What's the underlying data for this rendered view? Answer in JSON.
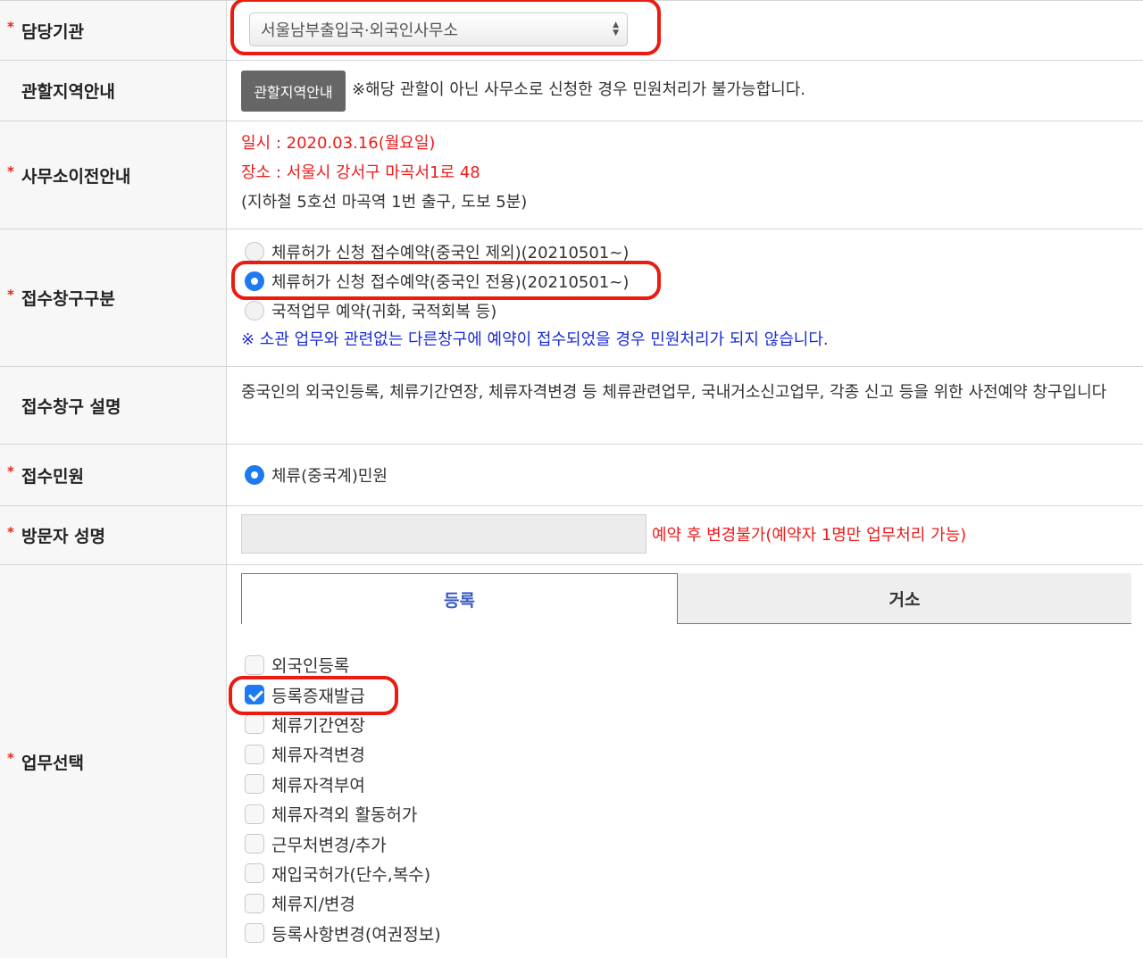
{
  "agency": {
    "label": "담당기관",
    "value": "서울남부출입국·외국인사무소"
  },
  "area": {
    "label": "관할지역안내",
    "button": "관할지역안내",
    "note": "※해당 관할이 아닌 사무소로 신청한 경우 민원처리가 불가능합니다."
  },
  "relocation": {
    "label": "사무소이전안내",
    "date": "일시 : 2020.03.16(월요일)",
    "place": "장소 : 서울시 강서구 마곡서1로 48",
    "access": "(지하철 5호선 마곡역 1번 출구, 도보 5분)"
  },
  "window_type": {
    "label": "접수창구구분",
    "options": [
      {
        "label": "체류허가 신청 접수예약(중국인 제외)(20210501~)",
        "selected": false
      },
      {
        "label": "체류허가 신청 접수예약(중국인 전용)(20210501~)",
        "selected": true
      },
      {
        "label": "국적업무 예약(귀화, 국적회복 등)",
        "selected": false
      }
    ],
    "warning": "※ 소관 업무와 관련없는 다른창구에 예약이 접수되었을 경우 민원처리가 되지 않습니다."
  },
  "window_desc": {
    "label": "접수창구 설명",
    "text": "중국인의 외국인등록, 체류기간연장, 체류자격변경 등 체류관련업무, 국내거소신고업무, 각종 신고 등을 위한 사전예약 창구입니다"
  },
  "civil": {
    "label": "접수민원",
    "option": "체류(중국계)민원",
    "selected": true
  },
  "visitor": {
    "label": "방문자 성명",
    "value": "",
    "note": "예약 후 변경불가(예약자 1명만 업무처리 가능)"
  },
  "task": {
    "label": "업무선택",
    "tabs": [
      {
        "label": "등록",
        "active": true
      },
      {
        "label": "거소",
        "active": false
      }
    ],
    "items": [
      {
        "label": "외국인등록",
        "checked": false
      },
      {
        "label": "등록증재발급",
        "checked": true
      },
      {
        "label": "체류기간연장",
        "checked": false
      },
      {
        "label": "체류자격변경",
        "checked": false
      },
      {
        "label": "체류자격부여",
        "checked": false
      },
      {
        "label": "체류자격외 활동허가",
        "checked": false
      },
      {
        "label": "근무처변경/추가",
        "checked": false
      },
      {
        "label": "재입국허가(단수,복수)",
        "checked": false
      },
      {
        "label": "체류지/변경",
        "checked": false
      },
      {
        "label": "등록사항변경(여권정보)",
        "checked": false
      }
    ]
  },
  "colors": {
    "required_star": "#e0291e",
    "highlight": "#ea1c12",
    "notice_red": "#ec1b1b",
    "notice_blue": "#1a2cd6",
    "radio_selected": "#1f7af2",
    "tab_active": "#3a5bc4"
  },
  "required_mark": "*"
}
